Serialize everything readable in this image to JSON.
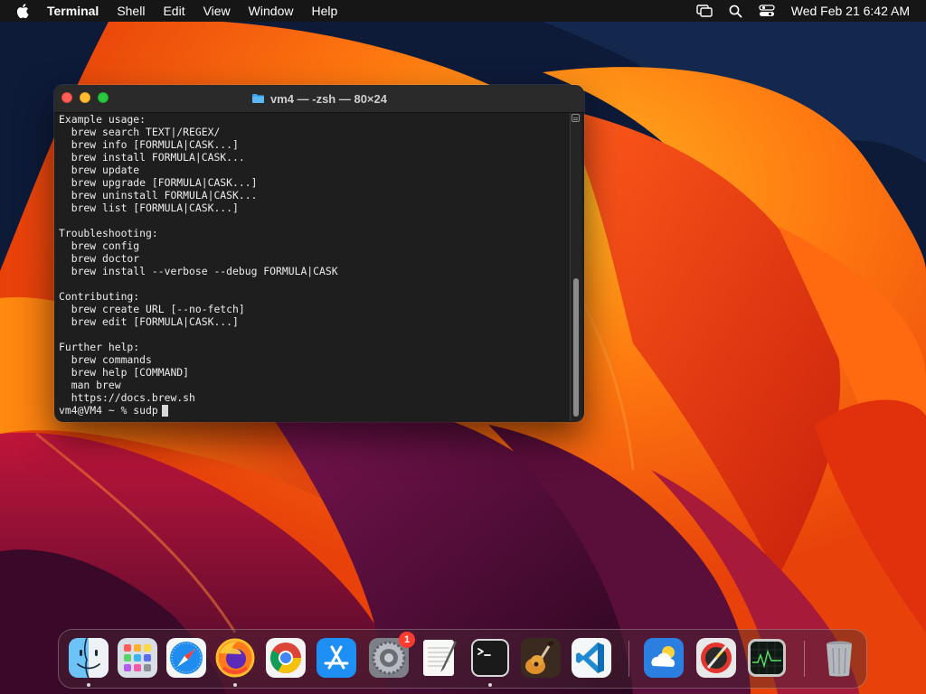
{
  "menubar": {
    "apple_icon": "apple-logo-icon",
    "app_name": "Terminal",
    "items": [
      "Shell",
      "Edit",
      "View",
      "Window",
      "Help"
    ],
    "status_icons": [
      "screen-mirroring-icon",
      "search-icon",
      "control-center-icon"
    ],
    "clock": "Wed Feb 21  6:42 AM"
  },
  "terminal": {
    "title": "vm4 — -zsh — 80×24",
    "title_icon": "folder-icon",
    "output": "Example usage:\n  brew search TEXT|/REGEX/\n  brew info [FORMULA|CASK...]\n  brew install FORMULA|CASK...\n  brew update\n  brew upgrade [FORMULA|CASK...]\n  brew uninstall FORMULA|CASK...\n  brew list [FORMULA|CASK...]\n\nTroubleshooting:\n  brew config\n  brew doctor\n  brew install --verbose --debug FORMULA|CASK\n\nContributing:\n  brew create URL [--no-fetch]\n  brew edit [FORMULA|CASK...]\n\nFurther help:\n  brew commands\n  brew help [COMMAND]\n  man brew\n  https://docs.brew.sh",
    "prompt": "vm4@VM4 ~ % ",
    "input": "sudp"
  },
  "dock": {
    "apps": [
      {
        "name": "Finder",
        "icon": "finder-icon",
        "running": true
      },
      {
        "name": "Launchpad",
        "icon": "launchpad-icon",
        "running": false
      },
      {
        "name": "Safari",
        "icon": "safari-icon",
        "running": false
      },
      {
        "name": "Firefox",
        "icon": "firefox-icon",
        "running": true
      },
      {
        "name": "Chrome",
        "icon": "chrome-icon",
        "running": false
      },
      {
        "name": "App Store",
        "icon": "app-store-icon",
        "running": false
      },
      {
        "name": "System Settings",
        "icon": "system-settings-icon",
        "running": false,
        "badge": "1"
      },
      {
        "name": "TextEdit",
        "icon": "textedit-icon",
        "running": false
      },
      {
        "name": "Terminal",
        "icon": "terminal-icon",
        "running": true
      },
      {
        "name": "GarageBand",
        "icon": "garageband-icon",
        "running": false
      },
      {
        "name": "Visual Studio Code",
        "icon": "vscode-icon",
        "running": false
      },
      {
        "name": "Weather",
        "icon": "weather-icon",
        "running": false
      },
      {
        "name": "Instruments",
        "icon": "instruments-icon",
        "running": false
      },
      {
        "name": "Activity Monitor",
        "icon": "activity-monitor-icon",
        "running": false
      },
      {
        "name": "Trash",
        "icon": "trash-icon",
        "running": false
      }
    ]
  },
  "colors": {
    "menubar_bg": "#161616",
    "terminal_bg": "#1e1e1e",
    "terminal_text": "#ececec",
    "close": "#fe5f57",
    "minimize": "#febc2e",
    "zoom": "#28c840",
    "badge": "#ff3b30"
  }
}
